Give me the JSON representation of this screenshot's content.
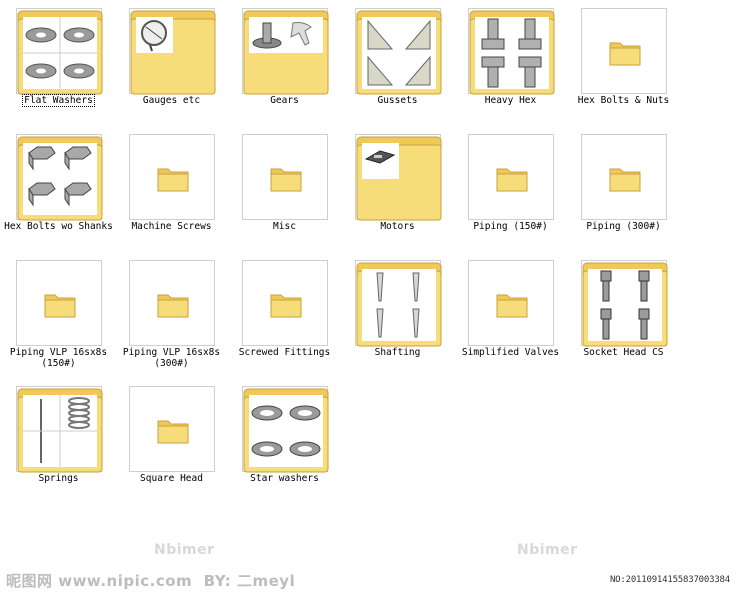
{
  "items": [
    {
      "label": "Flat Washers",
      "icon": "flat-washers-preview-icon",
      "selected": true
    },
    {
      "label": "Gauges etc",
      "icon": "gauges-preview-icon"
    },
    {
      "label": "Gears",
      "icon": "gears-preview-icon"
    },
    {
      "label": "Gussets",
      "icon": "gussets-preview-icon"
    },
    {
      "label": "Heavy Hex",
      "icon": "heavy-hex-preview-icon"
    },
    {
      "label": "Hex Bolts & Nuts",
      "icon": "folder-icon"
    },
    {
      "label": "Hex Bolts wo Shanks",
      "icon": "hex-bolts-preview-icon"
    },
    {
      "label": "Machine Screws",
      "icon": "folder-icon"
    },
    {
      "label": "Misc",
      "icon": "folder-icon"
    },
    {
      "label": "Motors",
      "icon": "motors-preview-icon"
    },
    {
      "label": "Piping (150#)",
      "icon": "folder-icon"
    },
    {
      "label": "Piping (300#)",
      "icon": "folder-icon"
    },
    {
      "label": "Piping VLP 16sx8s (150#)",
      "icon": "folder-icon"
    },
    {
      "label": "Piping VLP 16sx8s (300#)",
      "icon": "folder-icon"
    },
    {
      "label": "Screwed Fittings",
      "icon": "folder-icon"
    },
    {
      "label": "Shafting",
      "icon": "shafting-preview-icon"
    },
    {
      "label": "Simplified Valves",
      "icon": "folder-icon"
    },
    {
      "label": "Socket Head CS",
      "icon": "socket-head-preview-icon"
    },
    {
      "label": "Springs",
      "icon": "springs-preview-icon"
    },
    {
      "label": "Square Head",
      "icon": "folder-icon"
    },
    {
      "label": "Star washers",
      "icon": "star-washers-preview-icon"
    }
  ],
  "watermarks": {
    "brand": "Nbimer",
    "site": "昵图网 www.nipic.com",
    "by": "BY: 二meyl",
    "number": "NO:20110914155837003384"
  },
  "colors": {
    "folder_body": "#f7dc7a",
    "folder_back": "#efc95a",
    "folder_edge": "#c9a23c",
    "thumb_border": "#cfcfcf"
  }
}
